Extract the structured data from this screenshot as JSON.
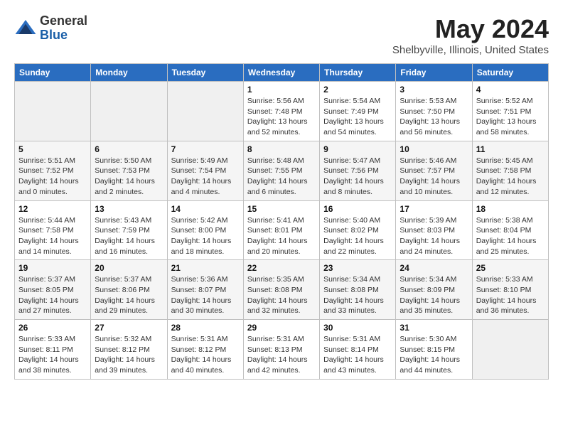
{
  "logo": {
    "general": "General",
    "blue": "Blue"
  },
  "title": "May 2024",
  "location": "Shelbyville, Illinois, United States",
  "days_of_week": [
    "Sunday",
    "Monday",
    "Tuesday",
    "Wednesday",
    "Thursday",
    "Friday",
    "Saturday"
  ],
  "weeks": [
    [
      {
        "day": "",
        "info": ""
      },
      {
        "day": "",
        "info": ""
      },
      {
        "day": "",
        "info": ""
      },
      {
        "day": "1",
        "info": "Sunrise: 5:56 AM\nSunset: 7:48 PM\nDaylight: 13 hours\nand 52 minutes."
      },
      {
        "day": "2",
        "info": "Sunrise: 5:54 AM\nSunset: 7:49 PM\nDaylight: 13 hours\nand 54 minutes."
      },
      {
        "day": "3",
        "info": "Sunrise: 5:53 AM\nSunset: 7:50 PM\nDaylight: 13 hours\nand 56 minutes."
      },
      {
        "day": "4",
        "info": "Sunrise: 5:52 AM\nSunset: 7:51 PM\nDaylight: 13 hours\nand 58 minutes."
      }
    ],
    [
      {
        "day": "5",
        "info": "Sunrise: 5:51 AM\nSunset: 7:52 PM\nDaylight: 14 hours\nand 0 minutes."
      },
      {
        "day": "6",
        "info": "Sunrise: 5:50 AM\nSunset: 7:53 PM\nDaylight: 14 hours\nand 2 minutes."
      },
      {
        "day": "7",
        "info": "Sunrise: 5:49 AM\nSunset: 7:54 PM\nDaylight: 14 hours\nand 4 minutes."
      },
      {
        "day": "8",
        "info": "Sunrise: 5:48 AM\nSunset: 7:55 PM\nDaylight: 14 hours\nand 6 minutes."
      },
      {
        "day": "9",
        "info": "Sunrise: 5:47 AM\nSunset: 7:56 PM\nDaylight: 14 hours\nand 8 minutes."
      },
      {
        "day": "10",
        "info": "Sunrise: 5:46 AM\nSunset: 7:57 PM\nDaylight: 14 hours\nand 10 minutes."
      },
      {
        "day": "11",
        "info": "Sunrise: 5:45 AM\nSunset: 7:58 PM\nDaylight: 14 hours\nand 12 minutes."
      }
    ],
    [
      {
        "day": "12",
        "info": "Sunrise: 5:44 AM\nSunset: 7:58 PM\nDaylight: 14 hours\nand 14 minutes."
      },
      {
        "day": "13",
        "info": "Sunrise: 5:43 AM\nSunset: 7:59 PM\nDaylight: 14 hours\nand 16 minutes."
      },
      {
        "day": "14",
        "info": "Sunrise: 5:42 AM\nSunset: 8:00 PM\nDaylight: 14 hours\nand 18 minutes."
      },
      {
        "day": "15",
        "info": "Sunrise: 5:41 AM\nSunset: 8:01 PM\nDaylight: 14 hours\nand 20 minutes."
      },
      {
        "day": "16",
        "info": "Sunrise: 5:40 AM\nSunset: 8:02 PM\nDaylight: 14 hours\nand 22 minutes."
      },
      {
        "day": "17",
        "info": "Sunrise: 5:39 AM\nSunset: 8:03 PM\nDaylight: 14 hours\nand 24 minutes."
      },
      {
        "day": "18",
        "info": "Sunrise: 5:38 AM\nSunset: 8:04 PM\nDaylight: 14 hours\nand 25 minutes."
      }
    ],
    [
      {
        "day": "19",
        "info": "Sunrise: 5:37 AM\nSunset: 8:05 PM\nDaylight: 14 hours\nand 27 minutes."
      },
      {
        "day": "20",
        "info": "Sunrise: 5:37 AM\nSunset: 8:06 PM\nDaylight: 14 hours\nand 29 minutes."
      },
      {
        "day": "21",
        "info": "Sunrise: 5:36 AM\nSunset: 8:07 PM\nDaylight: 14 hours\nand 30 minutes."
      },
      {
        "day": "22",
        "info": "Sunrise: 5:35 AM\nSunset: 8:08 PM\nDaylight: 14 hours\nand 32 minutes."
      },
      {
        "day": "23",
        "info": "Sunrise: 5:34 AM\nSunset: 8:08 PM\nDaylight: 14 hours\nand 33 minutes."
      },
      {
        "day": "24",
        "info": "Sunrise: 5:34 AM\nSunset: 8:09 PM\nDaylight: 14 hours\nand 35 minutes."
      },
      {
        "day": "25",
        "info": "Sunrise: 5:33 AM\nSunset: 8:10 PM\nDaylight: 14 hours\nand 36 minutes."
      }
    ],
    [
      {
        "day": "26",
        "info": "Sunrise: 5:33 AM\nSunset: 8:11 PM\nDaylight: 14 hours\nand 38 minutes."
      },
      {
        "day": "27",
        "info": "Sunrise: 5:32 AM\nSunset: 8:12 PM\nDaylight: 14 hours\nand 39 minutes."
      },
      {
        "day": "28",
        "info": "Sunrise: 5:31 AM\nSunset: 8:12 PM\nDaylight: 14 hours\nand 40 minutes."
      },
      {
        "day": "29",
        "info": "Sunrise: 5:31 AM\nSunset: 8:13 PM\nDaylight: 14 hours\nand 42 minutes."
      },
      {
        "day": "30",
        "info": "Sunrise: 5:31 AM\nSunset: 8:14 PM\nDaylight: 14 hours\nand 43 minutes."
      },
      {
        "day": "31",
        "info": "Sunrise: 5:30 AM\nSunset: 8:15 PM\nDaylight: 14 hours\nand 44 minutes."
      },
      {
        "day": "",
        "info": ""
      }
    ]
  ]
}
